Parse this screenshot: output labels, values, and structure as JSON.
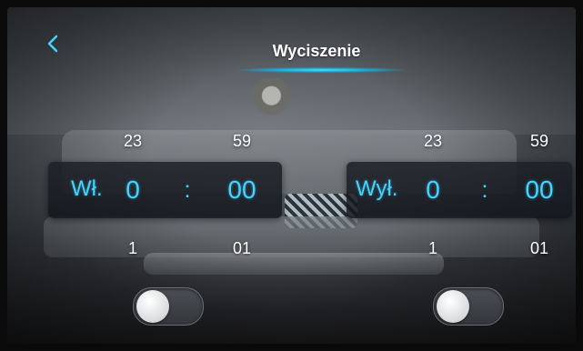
{
  "header": {
    "title": "Wyciszenie",
    "back_icon": "chevron-left-icon",
    "accent_color": "#45d2ff"
  },
  "on_timer": {
    "label": "Wł.",
    "hours": {
      "above": "23",
      "value": "0",
      "below": "1"
    },
    "separator": ":",
    "minutes": {
      "above": "59",
      "value": "00",
      "below": "01"
    },
    "enabled": false
  },
  "off_timer": {
    "label": "Wył.",
    "hours": {
      "above": "23",
      "value": "0",
      "below": "1"
    },
    "separator": ":",
    "minutes": {
      "above": "59",
      "value": "00",
      "below": "01"
    },
    "enabled": false
  }
}
